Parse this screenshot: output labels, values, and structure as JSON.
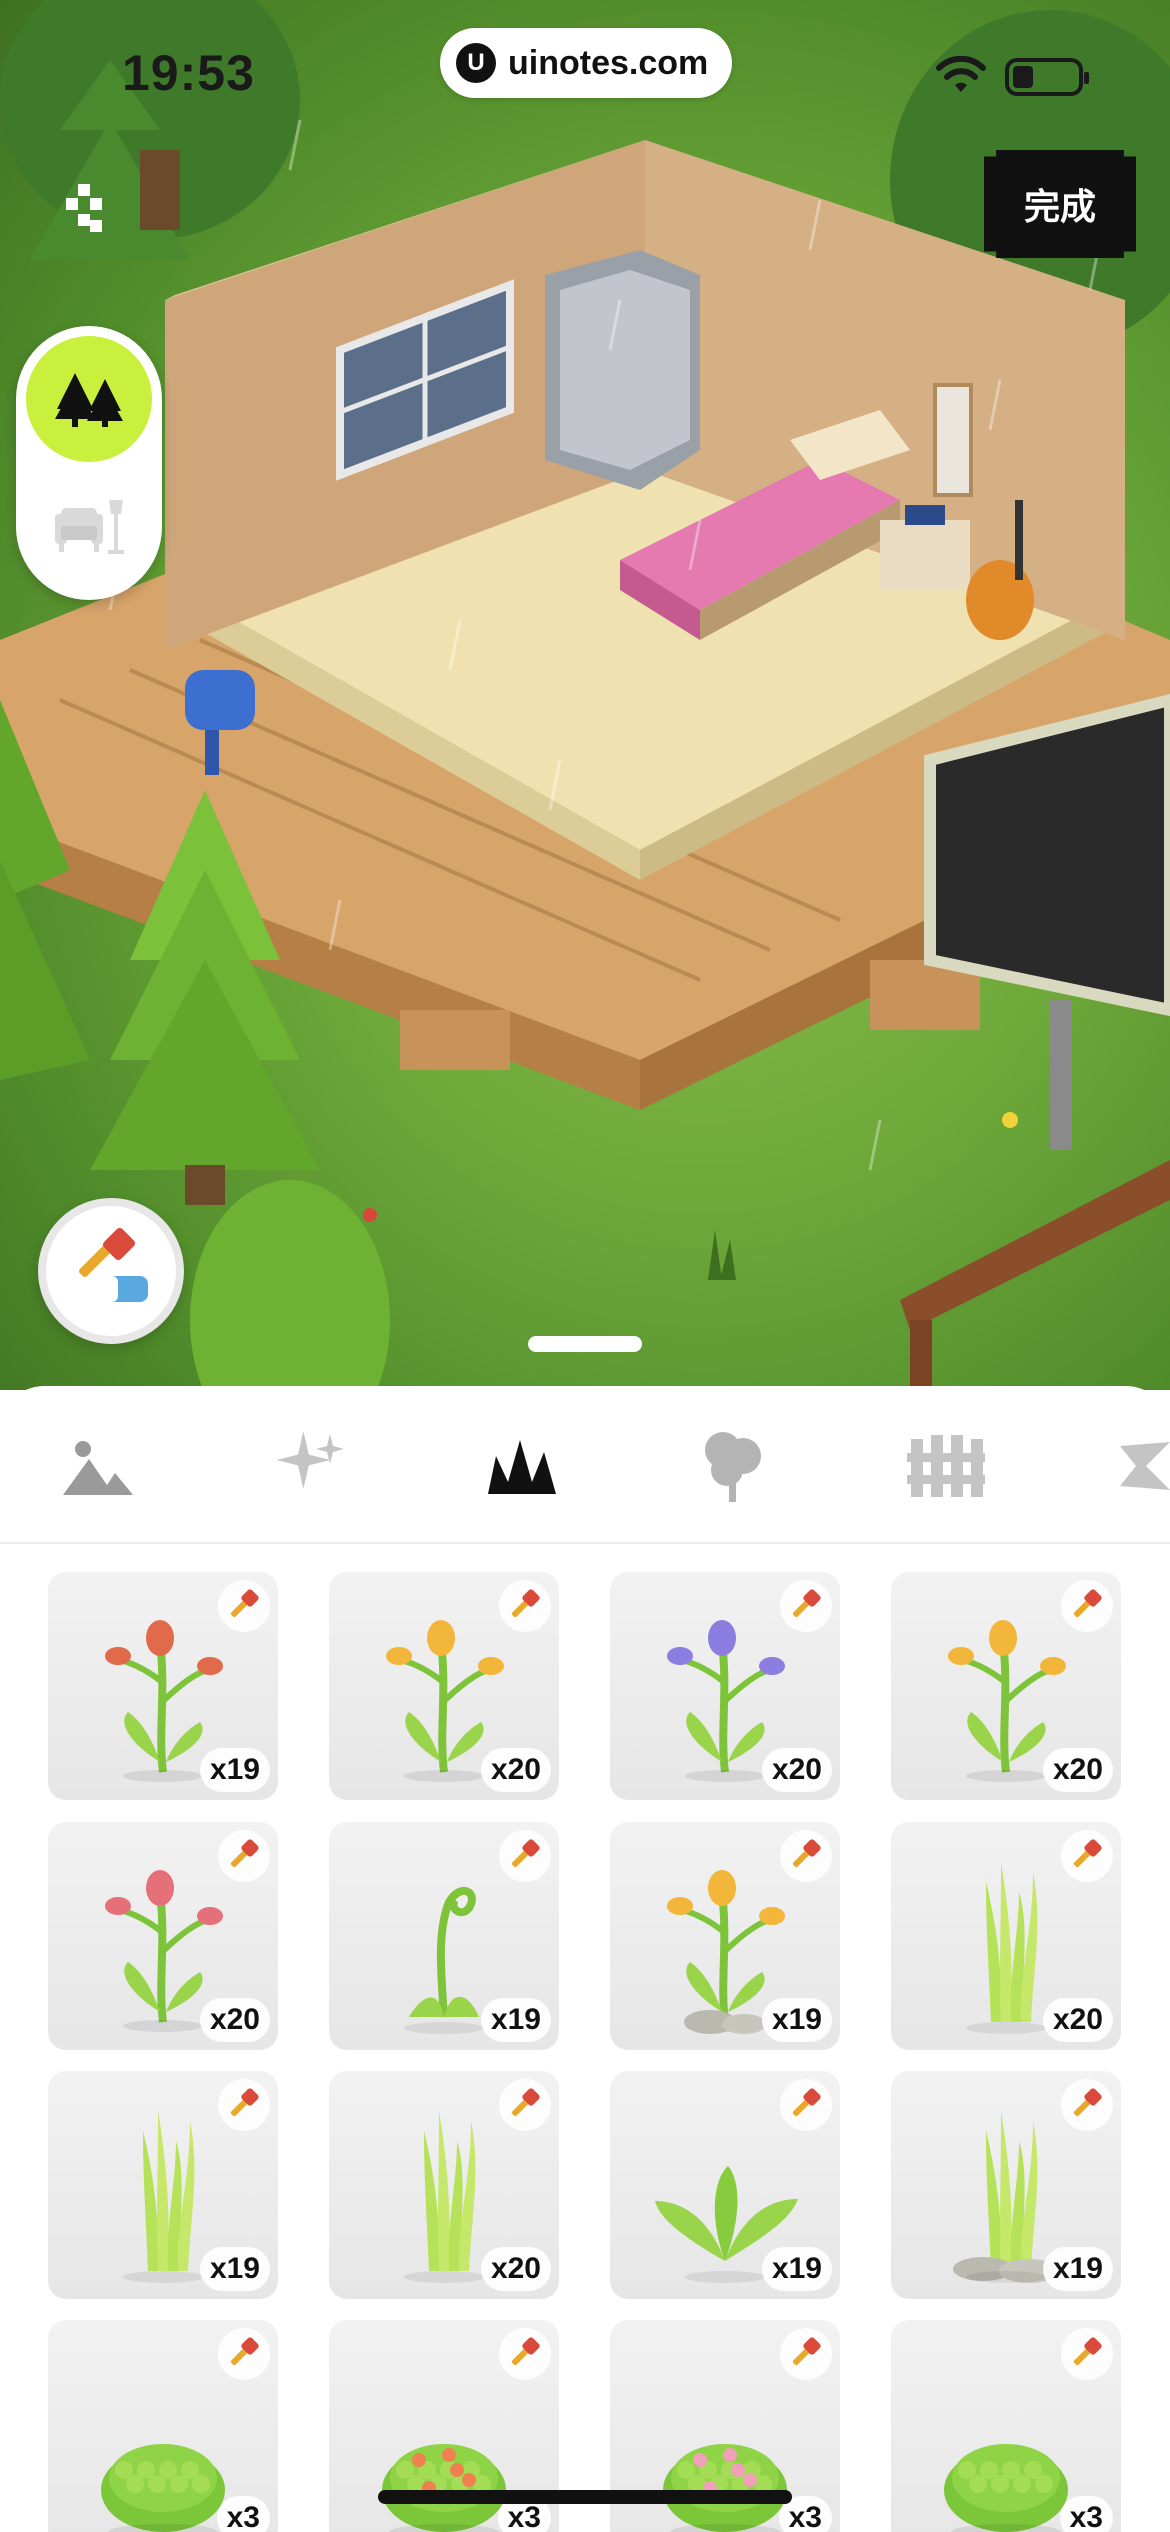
{
  "status_bar": {
    "time": "19:53",
    "url": "uinotes.com",
    "url_logo_letter": "U"
  },
  "top_bar": {
    "done_label": "完成"
  },
  "mode_toggle": [
    {
      "name": "outdoor",
      "icon": "trees-icon",
      "active": true
    },
    {
      "name": "indoor",
      "icon": "sofa-lamp-icon",
      "active": false
    }
  ],
  "category_tabs": [
    {
      "icon": "landscape-icon",
      "active": false
    },
    {
      "icon": "sparkles-icon",
      "active": false
    },
    {
      "icon": "grass-icon",
      "active": true
    },
    {
      "icon": "tree-icon",
      "active": false
    },
    {
      "icon": "fence-icon",
      "active": false
    },
    {
      "icon": "more-icon",
      "active": false
    }
  ],
  "items": [
    {
      "name": "red-tulip-single",
      "count": "x19",
      "flower": "#e06a4a"
    },
    {
      "name": "yellow-daisy-a",
      "count": "x20",
      "flower": "#f2b63a"
    },
    {
      "name": "purple-iris",
      "count": "x20",
      "flower": "#8c7de0"
    },
    {
      "name": "yellow-daisy-b",
      "count": "x20",
      "flower": "#f2b63a"
    },
    {
      "name": "red-tulips",
      "count": "x20",
      "flower": "#e5707a"
    },
    {
      "name": "fern-fiddlehead",
      "count": "x19",
      "flower": ""
    },
    {
      "name": "yellow-daisy-stones",
      "count": "x19",
      "flower": "#f2b63a"
    },
    {
      "name": "tall-grass-a",
      "count": "x20",
      "flower": ""
    },
    {
      "name": "tall-grass-b",
      "count": "x19",
      "flower": ""
    },
    {
      "name": "tall-grass-c",
      "count": "x20",
      "flower": ""
    },
    {
      "name": "leafy-plant",
      "count": "x19",
      "flower": ""
    },
    {
      "name": "grass-stones",
      "count": "x19",
      "flower": ""
    },
    {
      "name": "bush-plain-a",
      "count": "x3",
      "flower": ""
    },
    {
      "name": "bush-orange-flowers",
      "count": "x3",
      "flower": "#f08050"
    },
    {
      "name": "bush-pink-flowers",
      "count": "x3",
      "flower": "#f0a0b8"
    },
    {
      "name": "bush-plain-b",
      "count": "x3",
      "flower": ""
    }
  ],
  "colors": {
    "accent": "#c8f03c",
    "sheet": "#ffffff",
    "tile": "#ececec"
  }
}
